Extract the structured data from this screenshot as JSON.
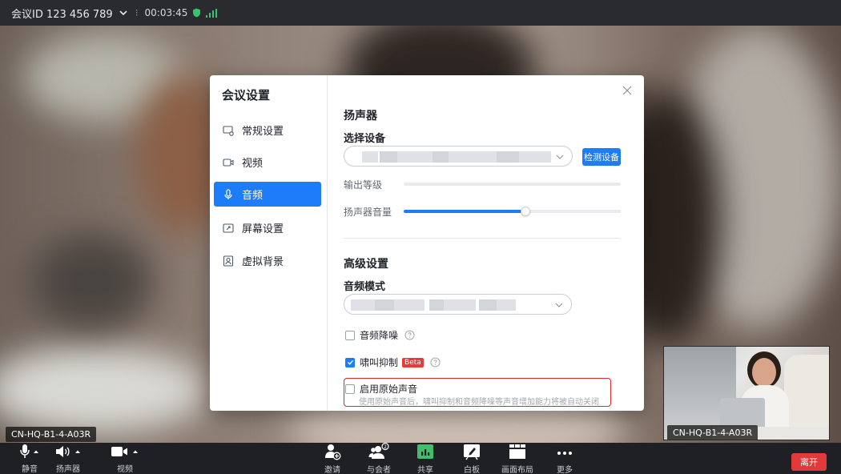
{
  "topbar": {
    "meeting_id": "会议ID 123 456 789",
    "separator": "⁝",
    "time": "00:03:45"
  },
  "video": {
    "main_label": "CN-HQ-B1-4-A03R",
    "pip_label": "CN-HQ-B1-4-A03R"
  },
  "dialog": {
    "title": "会议设置",
    "nav": [
      {
        "label": "常规设置",
        "icon": "general-settings-icon"
      },
      {
        "label": "视频",
        "icon": "video-camera-icon"
      },
      {
        "label": "音频",
        "icon": "microphone-icon",
        "active": true
      },
      {
        "label": "屏幕设置",
        "icon": "screen-share-icon"
      },
      {
        "label": "虚拟背景",
        "icon": "virtual-background-icon"
      }
    ],
    "speaker": {
      "heading": "扬声器",
      "select_label": "选择设备",
      "test_button": "检测设备",
      "output_level_label": "输出等级",
      "output_level": 0,
      "volume_label": "扬声器音量",
      "volume": 0.56
    },
    "advanced": {
      "heading": "高级设置",
      "audio_mode_label": "音频模式",
      "noise_reduction": {
        "label": "音频降噪",
        "checked": false
      },
      "howling": {
        "label": "啸叫抑制",
        "badge": "Beta",
        "checked": true
      },
      "original_sound": {
        "label": "启用原始声音",
        "checked": false,
        "note": "使用原始声音后，啸叫抑制和音频降噪等声音增加能力将被自动关闭"
      }
    }
  },
  "toolbar": {
    "mute": "静音",
    "speaker": "扬声器",
    "video": "视频",
    "invite": "邀请",
    "participants": "与会者",
    "share": "共享",
    "whiteboard": "白板",
    "layout": "画面布局",
    "more": "更多",
    "leave": "离开"
  },
  "colors": {
    "accent": "#1c7cf9",
    "leave": "#e23a3a",
    "highlight_border": "#e0282e",
    "share_green": "#3fbf6a"
  }
}
